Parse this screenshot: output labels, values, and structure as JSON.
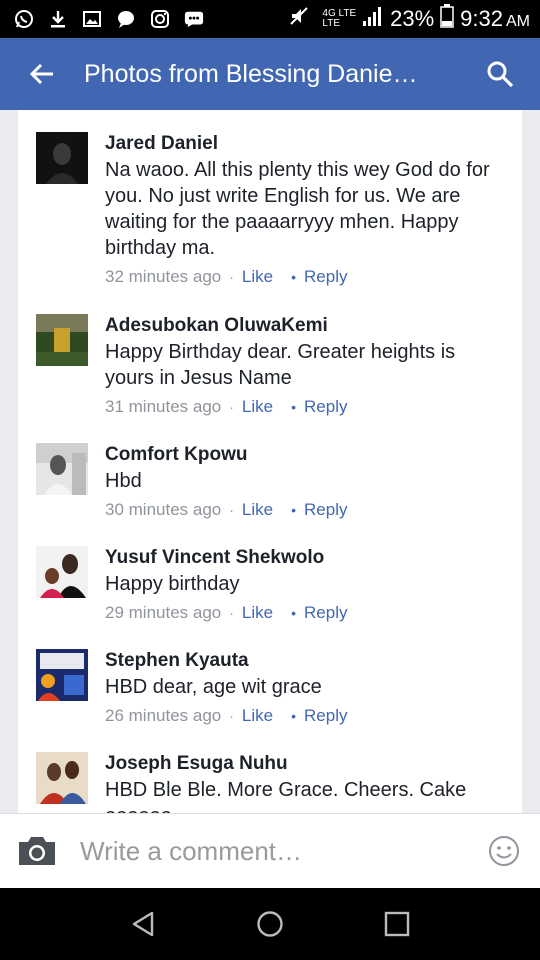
{
  "status_bar": {
    "network_top": "4G LTE",
    "network_bottom": "LTE",
    "battery": "23%",
    "time": "9:32",
    "ampm": "AM",
    "icons": [
      "whatsapp-icon",
      "download-icon",
      "gallery-icon",
      "chat-bubble-icon",
      "instagram-icon",
      "bbm-icon"
    ]
  },
  "app_bar": {
    "title": "Photos from Blessing Danie…"
  },
  "comments": [
    {
      "author": "Jared Daniel",
      "text": "Na waoo. All this plenty this wey God do for you. No just write English for us. We are waiting for the paaaarryyy mhen. Happy birthday ma.",
      "time": "32 minutes ago",
      "like": "Like",
      "reply": "Reply"
    },
    {
      "author": "Adesubokan OluwaKemi",
      "text": "Happy Birthday dear. Greater heights is yours in Jesus Name",
      "time": "31 minutes ago",
      "like": "Like",
      "reply": "Reply"
    },
    {
      "author": "Comfort Kpowu",
      "text": "Hbd",
      "time": "30 minutes ago",
      "like": "Like",
      "reply": "Reply"
    },
    {
      "author": "Yusuf Vincent Shekwolo",
      "text": "Happy birthday",
      "time": "29 minutes ago",
      "like": "Like",
      "reply": "Reply"
    },
    {
      "author": "Stephen Kyauta",
      "text": "HBD dear, age wit grace",
      "time": "26 minutes ago",
      "like": "Like",
      "reply": "Reply"
    },
    {
      "author": "Joseph Esuga Nuhu",
      "text": "HBD Ble Ble. More Grace. Cheers. Cake oooooo",
      "time": "",
      "like": "",
      "reply": ""
    }
  ],
  "composer": {
    "placeholder": "Write a comment…"
  },
  "colors": {
    "brand": "#4267b2",
    "link": "#4267b2",
    "meta": "#90949c"
  }
}
